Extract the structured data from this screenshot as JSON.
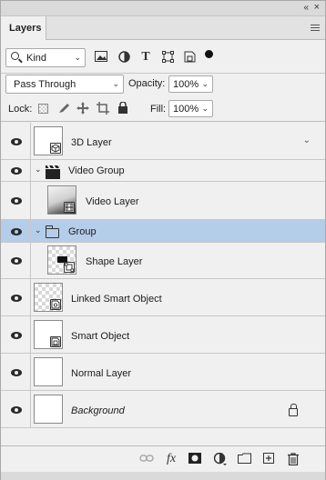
{
  "window": {
    "collapse_glyph": "«",
    "close_glyph": "×"
  },
  "tabs": [
    {
      "label": "Layers"
    }
  ],
  "filter": {
    "kind_label": "Kind",
    "icons": [
      "pixel-filter-icon",
      "adjustment-filter-icon",
      "type-filter-icon",
      "shape-filter-icon",
      "smart-object-filter-icon",
      "filter-toggle-icon"
    ]
  },
  "blend": {
    "mode": "Pass Through",
    "opacity_label": "Opacity:",
    "opacity_value": "100%"
  },
  "lock": {
    "label": "Lock:",
    "fill_label": "Fill:",
    "fill_value": "100%"
  },
  "layers": [
    {
      "name": "3D Layer",
      "type": "3d"
    },
    {
      "name": "Video Group",
      "type": "video-group"
    },
    {
      "name": "Video Layer",
      "type": "video"
    },
    {
      "name": "Group",
      "type": "group",
      "selected": true
    },
    {
      "name": "Shape Layer",
      "type": "shape"
    },
    {
      "name": "Linked Smart Object",
      "type": "linked-smart"
    },
    {
      "name": "Smart Object",
      "type": "smart"
    },
    {
      "name": "Normal Layer",
      "type": "normal"
    },
    {
      "name": "Background",
      "type": "background",
      "locked": true
    }
  ],
  "bottom_icons": [
    "link-layers-icon",
    "fx-icon",
    "layer-mask-icon",
    "adjustment-layer-icon",
    "new-group-icon",
    "new-layer-icon",
    "delete-layer-icon"
  ],
  "fx_label": "fx",
  "colors": {
    "selected_row": "#b4cde9",
    "panel_bg": "#f0f0f0"
  }
}
